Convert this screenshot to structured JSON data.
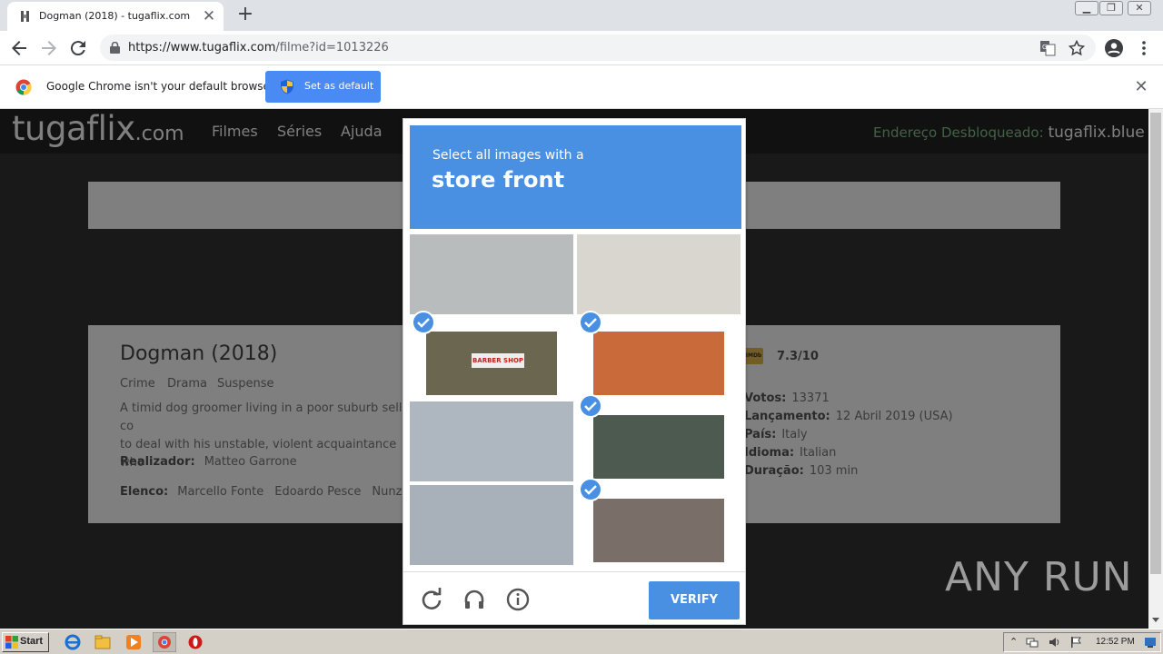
{
  "browser": {
    "tab_title": "Dogman (2018) - tugaflix.com",
    "url_host": "https://www.tugaflix.com",
    "url_path": "/filme?id=1013226",
    "infobar_text": "Google Chrome isn't your default browser",
    "infobar_button": "Set as default"
  },
  "site": {
    "logo_main": "tugaflix",
    "logo_suffix": ".com",
    "nav": [
      "Filmes",
      "Séries",
      "Ajuda"
    ],
    "unlocked_label": "Endereço Desbloqueado:",
    "unlocked_domain": "tugaflix.blue"
  },
  "movie": {
    "title": "Dogman (2018)",
    "genres": [
      "Crime",
      "Drama",
      "Suspense"
    ],
    "synopsis_line1": "A timid dog groomer living in a poor suburb sells co",
    "synopsis_line2": "to deal with his unstable, violent acquaintance who",
    "director_label": "Realizador:",
    "director": "Matteo Garrone",
    "cast_label": "Elenco:",
    "cast": [
      "Marcello Fonte",
      "Edoardo Pesce",
      "Nunzia"
    ],
    "imdb_badge": "IMDb",
    "rating": "7.3/10",
    "specs": [
      {
        "label": "Votos:",
        "value": "13371"
      },
      {
        "label": "Lançamento:",
        "value": "12 Abril 2019 (USA)"
      },
      {
        "label": "País:",
        "value": "Italy"
      },
      {
        "label": "Idioma:",
        "value": "Italian"
      },
      {
        "label": "Duração:",
        "value": "103 min"
      }
    ]
  },
  "captcha": {
    "instruction": "Select all images with a",
    "target": "store front",
    "tiles": [
      {
        "selected": false,
        "color": "#b9bcbd"
      },
      {
        "selected": false,
        "color": "#d9d6cf"
      },
      {
        "selected": true,
        "color": "#6a6650"
      },
      {
        "selected": true,
        "color": "#c96a3a"
      },
      {
        "selected": false,
        "color": "#aeb7c0"
      },
      {
        "selected": true,
        "color": "#4c5a50"
      },
      {
        "selected": false,
        "color": "#a8b1ba"
      },
      {
        "selected": true,
        "color": "#7a6f68"
      }
    ],
    "tile_text_barber": "BARBER SHOP",
    "verify_label": "VERIFY"
  },
  "watermark": "ANY RUN",
  "taskbar": {
    "start_label": "Start",
    "clock": "12:52 PM"
  },
  "colors": {
    "accent": "#4a90e2",
    "chrome_blue": "#4a8af4"
  }
}
